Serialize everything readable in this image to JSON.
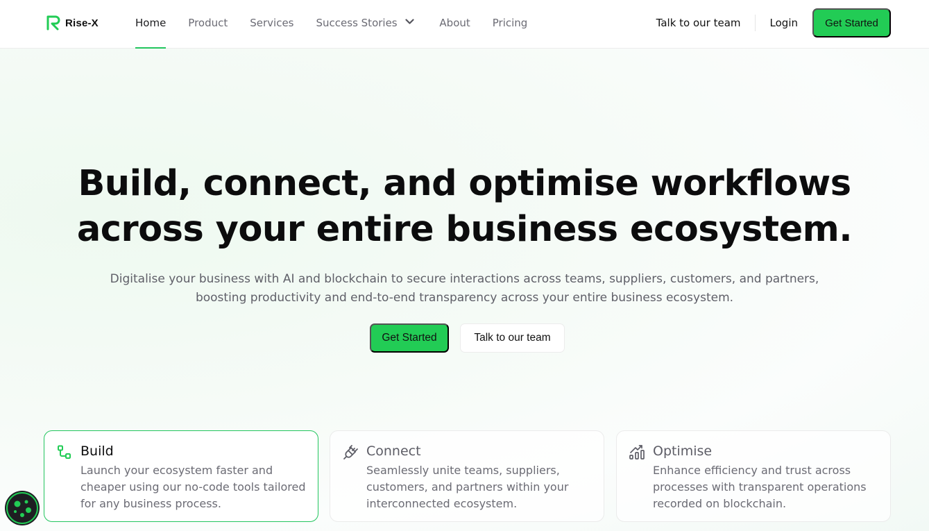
{
  "brand": {
    "name": "Rise-X",
    "accent": "#22cc55"
  },
  "nav": {
    "items": [
      {
        "label": "Home",
        "active": true
      },
      {
        "label": "Product",
        "active": false
      },
      {
        "label": "Services",
        "active": false
      },
      {
        "label": "Success Stories",
        "active": false,
        "has_dropdown": true
      },
      {
        "label": "About",
        "active": false
      },
      {
        "label": "Pricing",
        "active": false
      }
    ],
    "talk_label": "Talk to our team",
    "login_label": "Login",
    "cta_label": "Get Started"
  },
  "hero": {
    "title_line1": "Build, connect, and optimise workflows",
    "title_line2": "across your entire business ecosystem.",
    "subtitle_line1": "Digitalise your business with AI and blockchain to secure interactions across teams, suppliers, customers, and partners,",
    "subtitle_line2": "boosting productivity and end-to-end transparency across your entire business ecosystem.",
    "primary_cta": "Get Started",
    "secondary_cta": "Talk to our team"
  },
  "features": [
    {
      "icon": "workflow-icon",
      "title": "Build",
      "description": "Launch your ecosystem faster and cheaper using our no-code tools tailored for any business process.",
      "active": true
    },
    {
      "icon": "plug-icon",
      "title": "Connect",
      "description": "Seamlessly unite teams, suppliers, customers, and partners within your interconnected ecosystem.",
      "active": false
    },
    {
      "icon": "chart-growth-icon",
      "title": "Optimise",
      "description": "Enhance efficiency and trust across processes with transparent operations recorded on blockchain.",
      "active": false
    }
  ]
}
